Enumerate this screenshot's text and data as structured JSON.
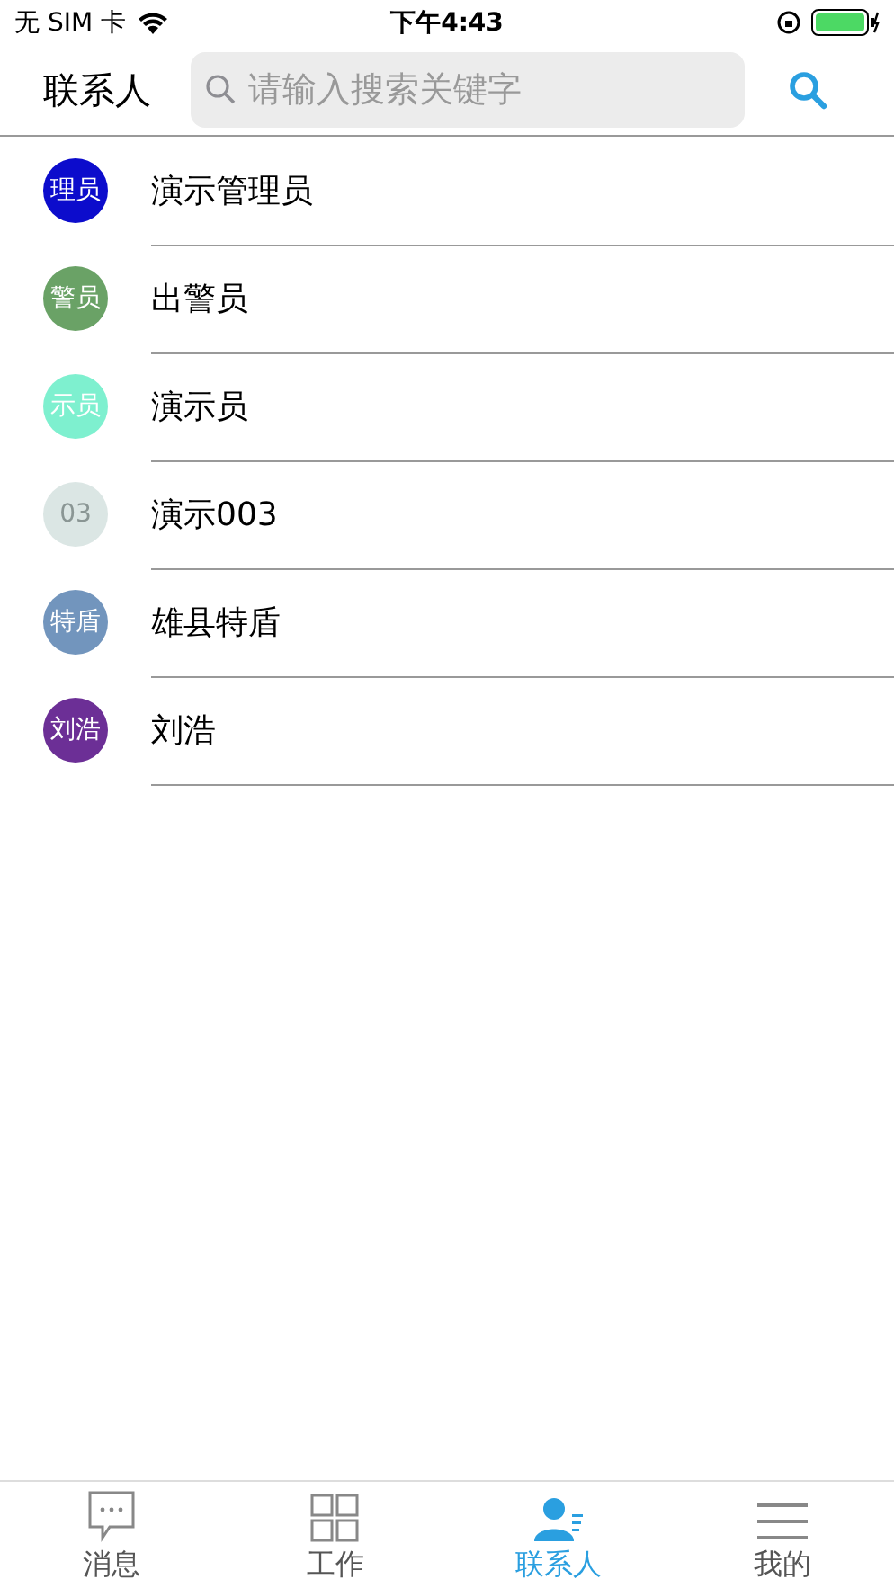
{
  "status_bar": {
    "carrier": "无 SIM 卡",
    "time": "下午4:43"
  },
  "header": {
    "title": "联系人",
    "search": {
      "placeholder": "请输入搜索关键字"
    }
  },
  "contacts": [
    {
      "avatar": "理员",
      "name": "演示管理员",
      "color": "#0c0ccc"
    },
    {
      "avatar": "警员",
      "name": "出警员",
      "color": "#6aa266"
    },
    {
      "avatar": "示员",
      "name": "演示员",
      "color": "#7ef0cf"
    },
    {
      "avatar": "03",
      "name": "演示003",
      "color": "#dbe6e4"
    },
    {
      "avatar": "特盾",
      "name": "雄县特盾",
      "color": "#7295bd"
    },
    {
      "avatar": "刘浩",
      "name": "刘浩",
      "color": "#6c2f96"
    }
  ],
  "tabs": [
    {
      "kind": "messages",
      "label": "消息",
      "selected": false
    },
    {
      "kind": "work",
      "label": "工作",
      "selected": false
    },
    {
      "kind": "contacts",
      "label": "联系人",
      "selected": true
    },
    {
      "kind": "mine",
      "label": "我的",
      "selected": false
    }
  ]
}
